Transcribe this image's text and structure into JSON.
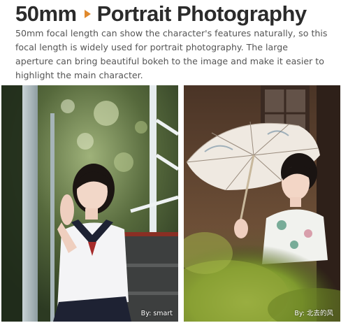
{
  "header": {
    "focal_length": "50mm",
    "title": "Portrait Photography"
  },
  "description": "50mm focal length can show the character's features naturally, so this focal length is widely used for portrait photography. The large aperture can bring beautiful bokeh to the image and make it easier to highlight the main character.",
  "photos": [
    {
      "credit": "By:  smart"
    },
    {
      "credit": "By:  北去的风"
    }
  ],
  "colors": {
    "accent": "#e0892d",
    "title": "#2b2b2b",
    "body_text": "#555555"
  }
}
